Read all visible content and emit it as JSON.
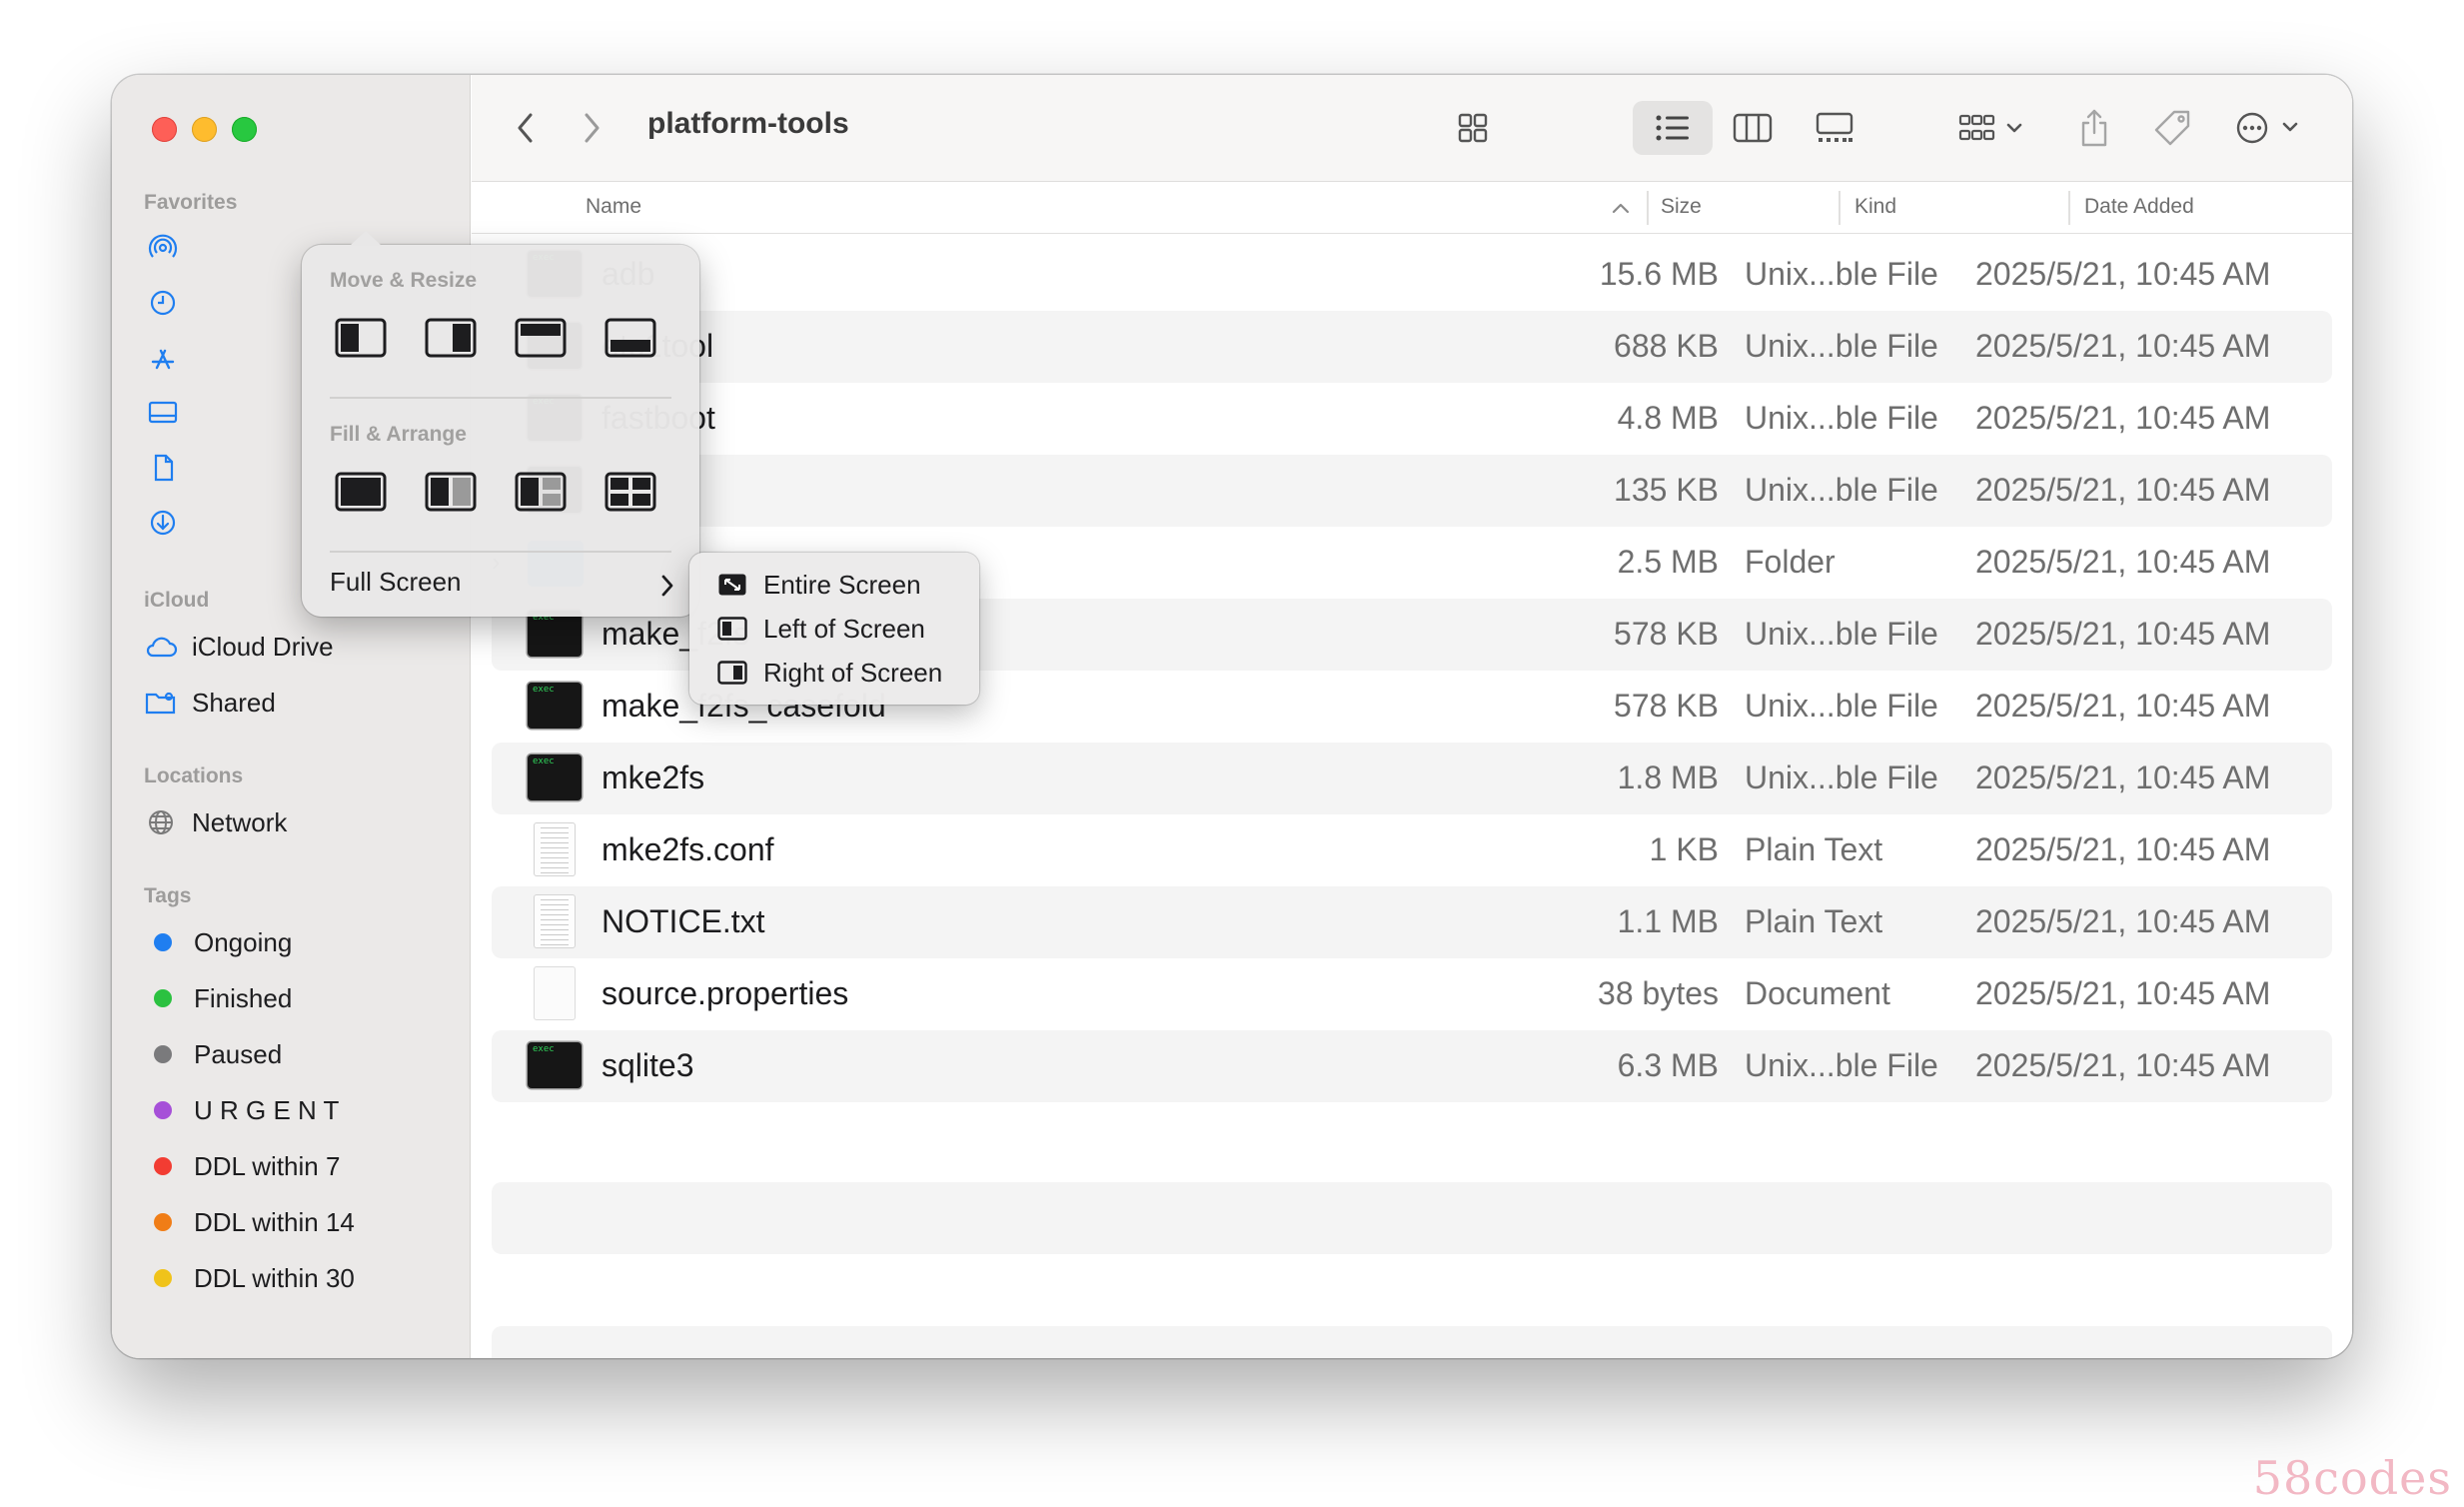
{
  "window": {
    "title": "platform-tools"
  },
  "sidebar": {
    "favorites_label": "Favorites",
    "favorites_icons": [
      "airdrop-icon",
      "recents-icon",
      "applications-icon",
      "desktop-icon",
      "documents-icon",
      "downloads-icon"
    ],
    "icloud_label": "iCloud",
    "icloud_items": [
      {
        "label": "iCloud Drive",
        "icon": "cloud-icon"
      },
      {
        "label": "Shared",
        "icon": "shared-folder-icon"
      }
    ],
    "locations_label": "Locations",
    "locations_items": [
      {
        "label": "Network",
        "icon": "globe-icon"
      }
    ],
    "tags_label": "Tags",
    "tags": [
      {
        "label": "Ongoing",
        "color": "#1f7ef0"
      },
      {
        "label": "Finished",
        "color": "#2bc140"
      },
      {
        "label": "Paused",
        "color": "#7a7a7c"
      },
      {
        "label": "U R G E N T",
        "color": "#a650d8"
      },
      {
        "label": "DDL within 7",
        "color": "#f23c32"
      },
      {
        "label": "DDL within 14",
        "color": "#f07d16"
      },
      {
        "label": "DDL within 30",
        "color": "#f0c31a"
      }
    ]
  },
  "toolbar": {
    "views": [
      "icon-view-icon",
      "list-view-icon",
      "column-view-icon",
      "gallery-view-icon"
    ],
    "active_view": "list-view-icon"
  },
  "columns": {
    "name": "Name",
    "size": "Size",
    "kind": "Kind",
    "date": "Date Added"
  },
  "files": [
    {
      "name": "adb",
      "size": "15.6 MB",
      "kind": "Unix...ble File",
      "date": "2025/5/21, 10:45 AM",
      "icon": "exec"
    },
    {
      "name": "etc1tool",
      "size": "688 KB",
      "kind": "Unix...ble File",
      "date": "2025/5/21, 10:45 AM",
      "icon": "exec"
    },
    {
      "name": "fastboot",
      "size": "4.8 MB",
      "kind": "Unix...ble File",
      "date": "2025/5/21, 10:45 AM",
      "icon": "exec"
    },
    {
      "name": "",
      "size": "135 KB",
      "kind": "Unix...ble File",
      "date": "2025/5/21, 10:45 AM",
      "icon": "exec"
    },
    {
      "name": "",
      "size": "2.5 MB",
      "kind": "Folder",
      "date": "2025/5/21, 10:45 AM",
      "icon": "folder"
    },
    {
      "name": "make_f2fs",
      "size": "578 KB",
      "kind": "Unix...ble File",
      "date": "2025/5/21, 10:45 AM",
      "icon": "exec"
    },
    {
      "name": "make_f2fs_casefold",
      "size": "578 KB",
      "kind": "Unix...ble File",
      "date": "2025/5/21, 10:45 AM",
      "icon": "exec"
    },
    {
      "name": "mke2fs",
      "size": "1.8 MB",
      "kind": "Unix...ble File",
      "date": "2025/5/21, 10:45 AM",
      "icon": "exec"
    },
    {
      "name": "mke2fs.conf",
      "size": "1 KB",
      "kind": "Plain Text",
      "date": "2025/5/21, 10:45 AM",
      "icon": "txt"
    },
    {
      "name": "NOTICE.txt",
      "size": "1.1 MB",
      "kind": "Plain Text",
      "date": "2025/5/21, 10:45 AM",
      "icon": "txt"
    },
    {
      "name": "source.properties",
      "size": "38 bytes",
      "kind": "Document",
      "date": "2025/5/21, 10:45 AM",
      "icon": "doc"
    },
    {
      "name": "sqlite3",
      "size": "6.3 MB",
      "kind": "Unix...ble File",
      "date": "2025/5/21, 10:45 AM",
      "icon": "exec"
    }
  ],
  "popover": {
    "move_resize_label": "Move & Resize",
    "fill_arrange_label": "Fill & Arrange",
    "full_screen_label": "Full Screen"
  },
  "submenu": {
    "items": [
      "Entire Screen",
      "Left of Screen",
      "Right of Screen"
    ]
  },
  "watermark": "58codes"
}
